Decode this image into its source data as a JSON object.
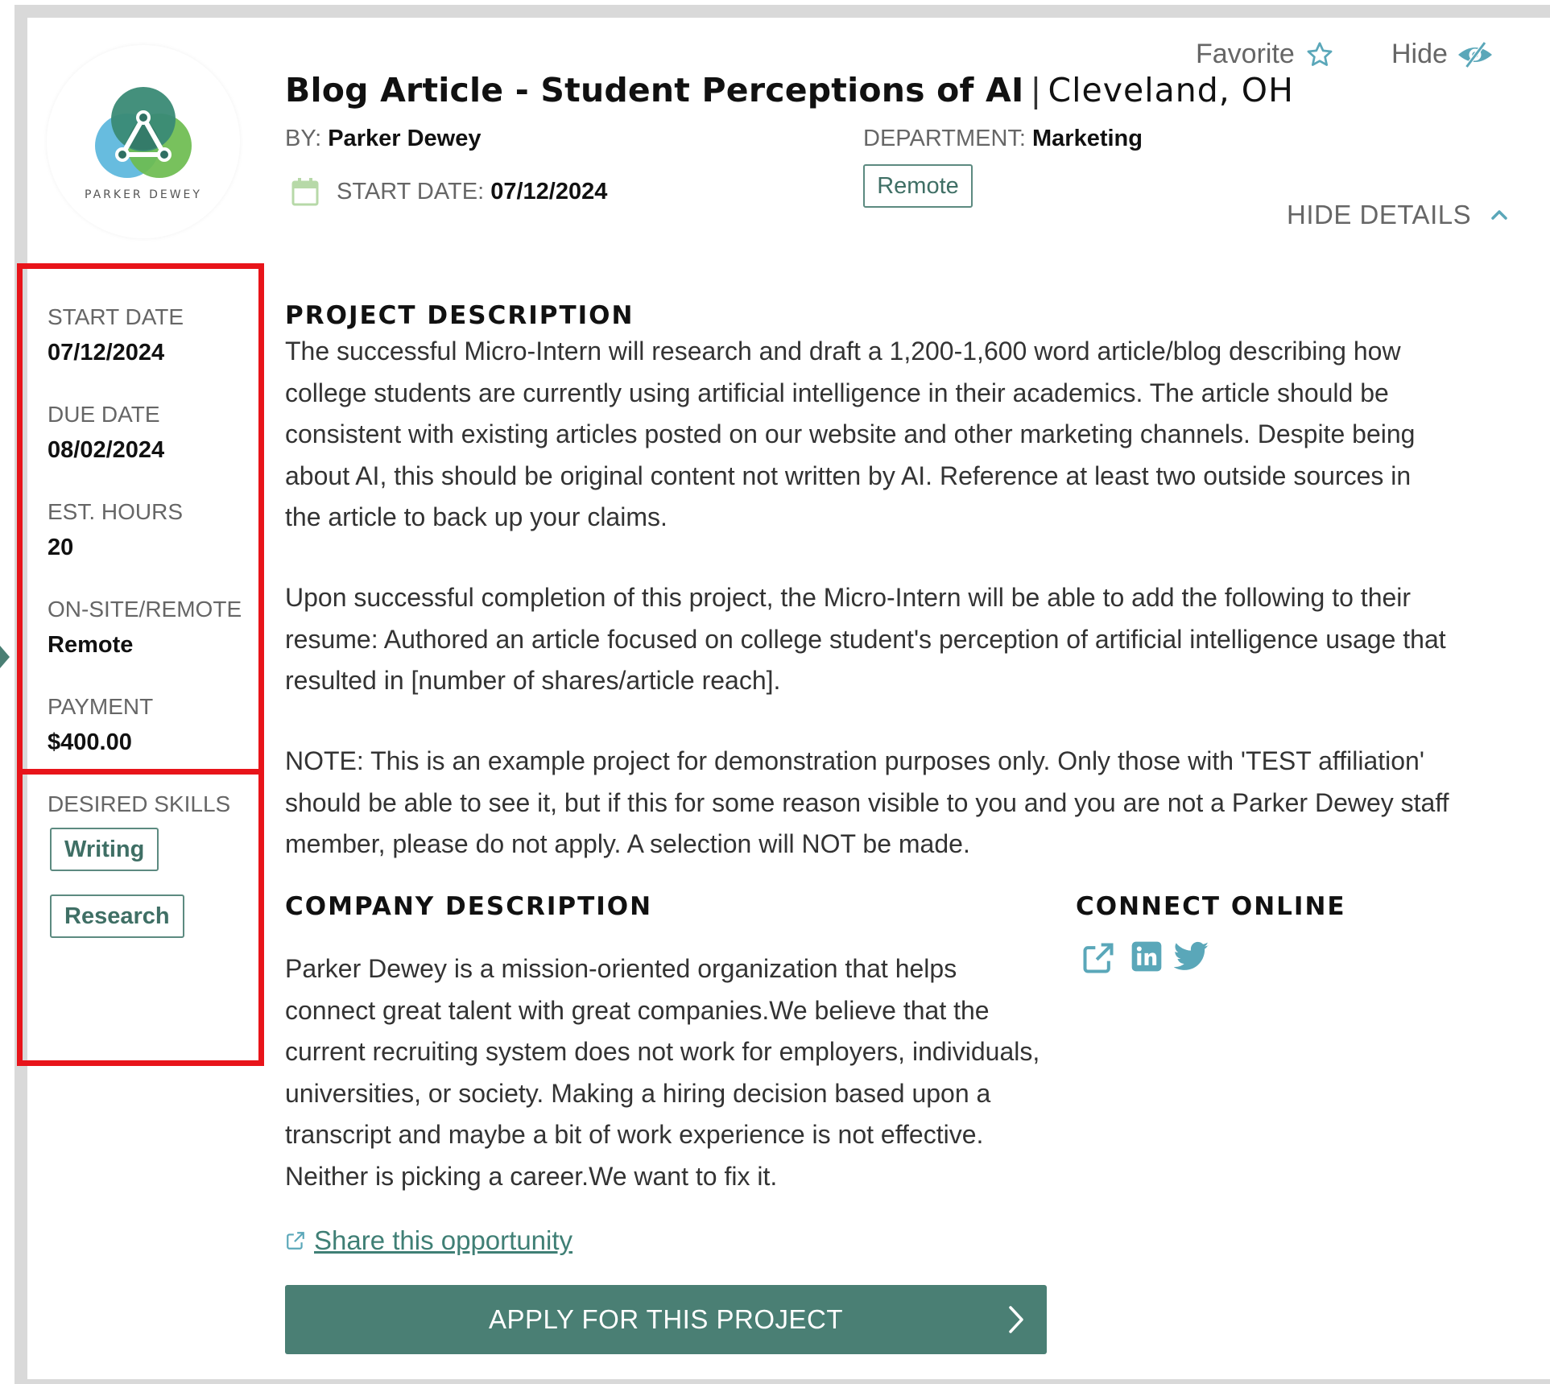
{
  "header": {
    "title": "Blog Article - Student Perceptions of AI",
    "separator": "|",
    "location": "Cleveland, OH",
    "favorite_label": "Favorite",
    "hide_label": "Hide",
    "by_label": "BY:",
    "by_value": "Parker Dewey",
    "department_label": "DEPARTMENT:",
    "department_value": "Marketing",
    "start_label": "START DATE:",
    "start_value": "07/12/2024",
    "work_tag": "Remote",
    "hide_details_label": "HIDE DETAILS"
  },
  "logo": {
    "text": "PARKER DEWEY"
  },
  "sidebar": {
    "meta": [
      {
        "label": "START DATE",
        "value": "07/12/2024"
      },
      {
        "label": "DUE DATE",
        "value": "08/02/2024"
      },
      {
        "label": "EST. HOURS",
        "value": "20"
      },
      {
        "label": "ON-SITE/REMOTE",
        "value": "Remote"
      },
      {
        "label": "PAYMENT",
        "value": "$400.00"
      }
    ],
    "skills_label": "DESIRED SKILLS",
    "skills": [
      "Writing",
      "Research"
    ]
  },
  "project": {
    "heading": "PROJECT DESCRIPTION",
    "p1": "The successful Micro-Intern will research and draft a 1,200-1,600 word article/blog describing how college students are currently using artificial intelligence in their academics. The article should be consistent with existing articles posted on our website and other marketing channels. Despite being about AI, this should be original content not written by AI. Reference at least two outside sources in the article to back up your claims.",
    "p2": "Upon successful completion of this project, the Micro-Intern will be able to add the following to their resume: Authored an article focused on college student's perception of artificial intelligence usage that resulted in [number of shares/article reach].",
    "p3": "NOTE: This is an example project for demonstration purposes only. Only those with 'TEST affiliation' should be able to see it, but if this for some reason visible to you and you are not a Parker Dewey staff member, please do not apply. A selection will NOT be made."
  },
  "company": {
    "heading": "COMPANY DESCRIPTION",
    "text": "Parker Dewey is a mission-oriented organization that helps connect great talent with great companies.We believe that the current recruiting system does not work for employers, individuals, universities, or society. Making a hiring decision based upon a transcript and maybe a bit of work experience is not effective. Neither is picking a career.We want to fix it."
  },
  "connect": {
    "heading": "CONNECT ONLINE",
    "icons": [
      "external-link-icon",
      "linkedin-icon",
      "twitter-icon"
    ]
  },
  "actions": {
    "share_label": "Share this opportunity",
    "apply_label": "APPLY FOR THIS PROJECT"
  },
  "colors": {
    "accent": "#4a7f74",
    "highlight_box": "#e8141a",
    "icon_teal": "#5aa7b9"
  }
}
